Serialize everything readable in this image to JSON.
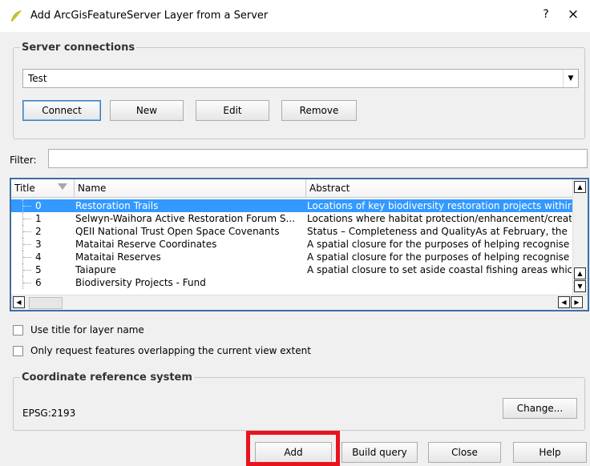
{
  "window": {
    "title": "Add ArcGisFeatureServer Layer from a Server",
    "help_glyph": "?",
    "close_glyph": "×",
    "app_icon": "qgis-logo"
  },
  "server_connections": {
    "legend": "Server connections",
    "selected": "Test",
    "buttons": {
      "connect": "Connect",
      "new": "New",
      "edit": "Edit",
      "remove": "Remove"
    }
  },
  "filter": {
    "label": "Filter:",
    "value": ""
  },
  "table": {
    "columns": [
      "Title",
      "Name",
      "Abstract"
    ],
    "rows": [
      {
        "title": "0",
        "name": "Restoration Trails",
        "abstract": "Locations of key biodiversity restoration projects within",
        "selected": true
      },
      {
        "title": "1",
        "name": "Selwyn-Waihora Active Restoration Forum S...",
        "abstract": "Locations where habitat protection/enhancement/creat",
        "selected": false
      },
      {
        "title": "2",
        "name": "QEII National Trust Open Space Covenants",
        "abstract": "Status – Completeness and QualityAs at February, the",
        "selected": false
      },
      {
        "title": "3",
        "name": "Mataitai Reserve Coordinates",
        "abstract": "A spatial closure for the purposes of helping recognise",
        "selected": false
      },
      {
        "title": "4",
        "name": "Mataitai Reserves",
        "abstract": "A spatial closure for the purposes of helping recognise",
        "selected": false
      },
      {
        "title": "5",
        "name": "Taiapure",
        "abstract": "A spatial closure to set aside coastal fishing areas which",
        "selected": false
      },
      {
        "title": "6",
        "name": "Biodiversity Projects - Fund",
        "abstract": "",
        "selected": false
      }
    ]
  },
  "options": {
    "use_title": {
      "label": "Use title for layer name",
      "checked": false
    },
    "only_request": {
      "label": "Only request features overlapping the current view extent",
      "checked": false
    }
  },
  "crs": {
    "legend": "Coordinate reference system",
    "value": "EPSG:2193",
    "change": "Change..."
  },
  "footer": {
    "add": "Add",
    "build_query": "Build query",
    "close": "Close",
    "help": "Help"
  },
  "colors": {
    "selection": "#3399ff",
    "highlight": "#e8141c",
    "table_border": "#3b6fa4"
  }
}
